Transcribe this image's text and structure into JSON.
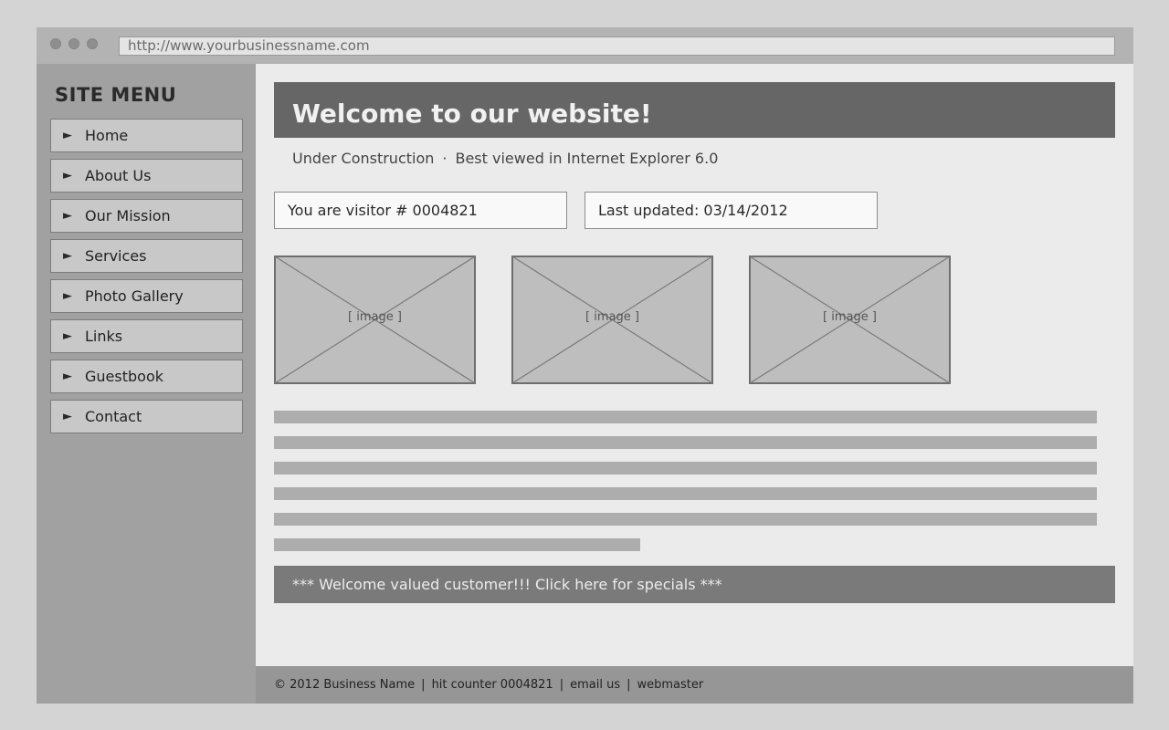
{
  "browser": {
    "url": "http://www.yourbusinessname.com"
  },
  "sidebar": {
    "title": "SITE MENU",
    "arrow_glyph": "►",
    "items": [
      {
        "label": "Home"
      },
      {
        "label": "About Us"
      },
      {
        "label": "Our Mission"
      },
      {
        "label": "Services"
      },
      {
        "label": "Photo Gallery"
      },
      {
        "label": "Links"
      },
      {
        "label": "Guestbook"
      },
      {
        "label": "Contact"
      }
    ]
  },
  "main": {
    "banner_title": "Welcome to our website!",
    "subline": {
      "left": "Under Construction",
      "separator": "·",
      "right": "Best viewed in Internet Explorer 6.0"
    },
    "visitor_text": "You are visitor # 0004821",
    "updated_text": "Last updated: 03/14/2012",
    "image_placeholders": [
      {
        "label": "[ image ]"
      },
      {
        "label": "[ image ]"
      },
      {
        "label": "[ image ]"
      }
    ],
    "specials_text": "*** Welcome valued customer!!! Click here for specials ***"
  },
  "footer": {
    "copyright": "© 2012 Business Name",
    "separator": "|",
    "hit_counter": "hit counter 0004821",
    "email": "email us",
    "webmaster": "webmaster"
  },
  "colors": {
    "page_bg": "#d4d4d4",
    "content_bg": "#ebebeb",
    "sidebar_bg": "#a1a1a1",
    "banner_bg": "#666666",
    "specials_bg": "#7a7a7a",
    "footer_bg": "#969696"
  }
}
